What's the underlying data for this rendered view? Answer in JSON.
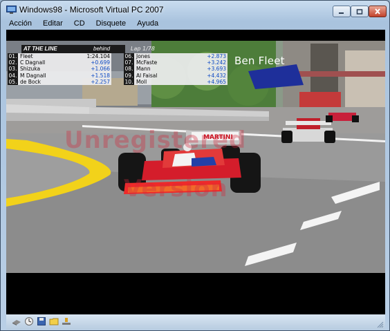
{
  "window": {
    "title": "Windows98 - Microsoft Virtual PC 2007"
  },
  "menu": [
    "Acción",
    "Editar",
    "CD",
    "Disquete",
    "Ayuda"
  ],
  "game": {
    "header_title": "AT THE LINE",
    "header_behind": "behind",
    "header_lap": "Lap 1/78",
    "focus_driver": "Ben Fleet",
    "standings_left": [
      {
        "pos": "01.",
        "name": "Fleet",
        "gap": "1:24.104"
      },
      {
        "pos": "02.",
        "name": "C Dagnall",
        "gap": "+0.699"
      },
      {
        "pos": "03.",
        "name": "Shizuka",
        "gap": "+1.066"
      },
      {
        "pos": "04.",
        "name": "M Dagnall",
        "gap": "+1.518"
      },
      {
        "pos": "05.",
        "name": "de Bock",
        "gap": "+2.257"
      }
    ],
    "standings_right": [
      {
        "pos": "06.",
        "name": "Jones",
        "gap": "+2.873"
      },
      {
        "pos": "07.",
        "name": "McFaste",
        "gap": "+3.242"
      },
      {
        "pos": "08.",
        "name": "Mann",
        "gap": "+3.693"
      },
      {
        "pos": "09.",
        "name": "Al Faisal",
        "gap": "+4.432"
      },
      {
        "pos": "10.",
        "name": "Moll",
        "gap": "+4.965"
      }
    ],
    "sponsor": "MARTINI",
    "watermark_line1": "Unregistered",
    "watermark_line2": "Version"
  },
  "statusbar_icons": [
    "disk-icon",
    "clock-icon",
    "floppy-icon",
    "folder-icon",
    "network-icon"
  ],
  "colors": {
    "titlebar_top": "#c9dcef",
    "titlebar_bottom": "#a9c3de",
    "hud_text_blue": "#0b48c4",
    "curb_yellow": "#f2d21a"
  }
}
